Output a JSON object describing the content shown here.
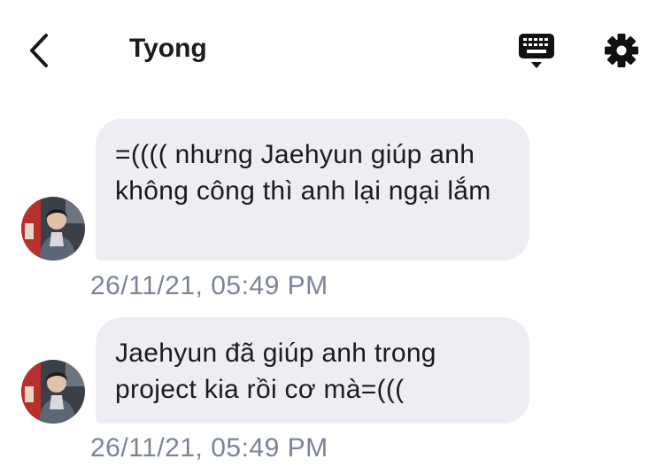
{
  "header": {
    "contact_name": "Tyong",
    "back_icon": "chevron-left-icon",
    "keyboard_icon": "keyboard-icon",
    "settings_icon": "gear-icon"
  },
  "messages": [
    {
      "text": "=(((( nhưng Jaehyun giúp anh không công thì anh lại ngại lắm",
      "timestamp": "26/11/21, 05:49 PM"
    },
    {
      "text": "Jaehyun đã giúp anh trong project kia rồi cơ mà=(((",
      "timestamp": "26/11/21, 05:49 PM"
    }
  ],
  "colors": {
    "bubble": "#eceef3",
    "timestamp": "#7a8496",
    "text": "#1b1b1b"
  }
}
